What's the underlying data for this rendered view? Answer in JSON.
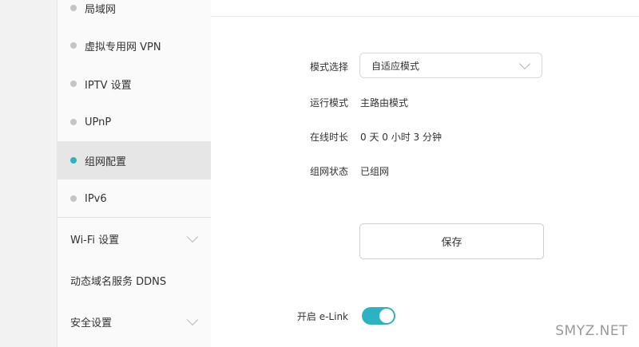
{
  "sidebar": {
    "sub_items": [
      {
        "label": "局域网",
        "active": false
      },
      {
        "label": "虚拟专用网 VPN",
        "active": false
      },
      {
        "label": "IPTV 设置",
        "active": false
      },
      {
        "label": "UPnP",
        "active": false
      },
      {
        "label": "组网配置",
        "active": true
      },
      {
        "label": "IPv6",
        "active": false
      }
    ],
    "top_items": [
      {
        "label": "Wi-Fi 设置",
        "expandable": true
      },
      {
        "label": "动态域名服务 DDNS",
        "expandable": false
      },
      {
        "label": "安全设置",
        "expandable": true
      }
    ]
  },
  "form": {
    "mode_label": "模式选择",
    "mode_value": "自适应模式",
    "run_mode_label": "运行模式",
    "run_mode_value": "主路由模式",
    "online_label": "在线时长",
    "online_value": "0 天 0 小时 3 分钟",
    "net_status_label": "组网状态",
    "net_status_value": "已组网",
    "save_label": "保存",
    "elink_label": "开启 e-Link",
    "elink_on": true
  },
  "watermark": "SMYZ.NET",
  "colors": {
    "accent": "#2bb3c1"
  },
  "icons": {
    "expand": "chevron-down-icon",
    "bullet": "dot-icon"
  }
}
